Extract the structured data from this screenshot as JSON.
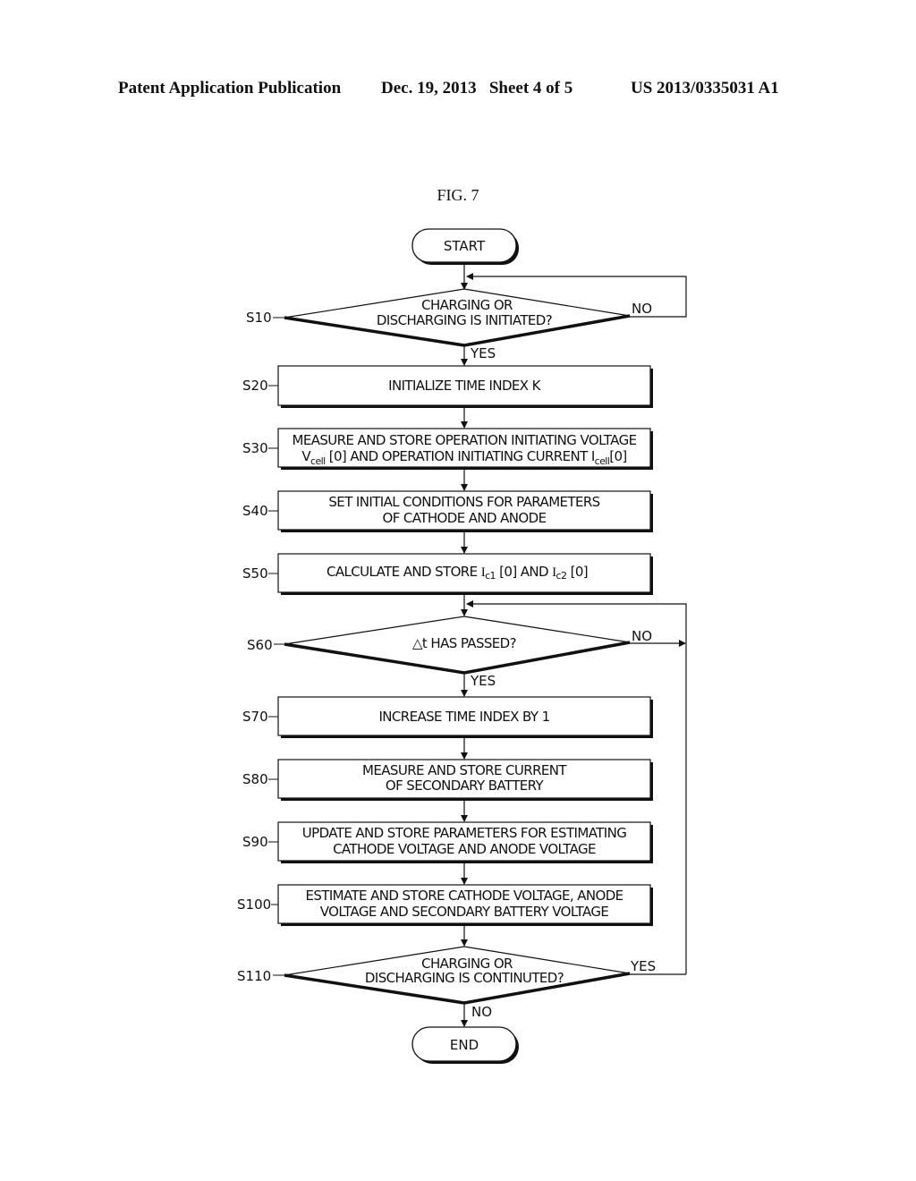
{
  "header": {
    "publication": "Patent Application Publication",
    "date_sheet": "Dec. 19, 2013   Sheet 4 of 5",
    "number": "US 2013/0335031 A1"
  },
  "figure": {
    "title": "FIG. 7"
  },
  "flowchart": {
    "start": "START",
    "end": "END",
    "steps": [
      {
        "id": "S10",
        "type": "decision",
        "lines": [
          "CHARGING OR",
          "DISCHARGING IS INITIATED?"
        ],
        "yes": "YES",
        "no": "NO"
      },
      {
        "id": "S20",
        "type": "process",
        "lines": [
          "INITIALIZE TIME INDEX K"
        ]
      },
      {
        "id": "S30",
        "type": "process",
        "lines": [
          "MEASURE AND STORE OPERATION INITIATING VOLTAGE",
          "V_cell [0] AND OPERATION INITIATING CURRENT I_cell[0]"
        ]
      },
      {
        "id": "S40",
        "type": "process",
        "lines": [
          "SET INITIAL CONDITIONS FOR PARAMETERS",
          "OF CATHODE AND ANODE"
        ]
      },
      {
        "id": "S50",
        "type": "process",
        "lines": [
          "CALCULATE AND STORE I_c1 [0] AND I_c2 [0]"
        ]
      },
      {
        "id": "S60",
        "type": "decision",
        "lines": [
          "△t HAS PASSED?"
        ],
        "yes": "YES",
        "no": "NO"
      },
      {
        "id": "S70",
        "type": "process",
        "lines": [
          "INCREASE TIME INDEX BY 1"
        ]
      },
      {
        "id": "S80",
        "type": "process",
        "lines": [
          "MEASURE AND STORE CURRENT",
          "OF SECONDARY BATTERY"
        ]
      },
      {
        "id": "S90",
        "type": "process",
        "lines": [
          "UPDATE AND STORE PARAMETERS FOR ESTIMATING",
          "CATHODE VOLTAGE AND ANODE VOLTAGE"
        ]
      },
      {
        "id": "S100",
        "type": "process",
        "lines": [
          "ESTIMATE AND STORE CATHODE VOLTAGE, ANODE",
          "VOLTAGE AND SECONDARY BATTERY VOLTAGE"
        ]
      },
      {
        "id": "S110",
        "type": "decision",
        "lines": [
          "CHARGING OR",
          "DISCHARGING IS CONTINUTED?"
        ],
        "yes": "YES",
        "no": "NO"
      }
    ],
    "s30_parts": {
      "line1": "MEASURE AND STORE OPERATION INITIATING VOLTAGE",
      "v": "V",
      "v_sub": "cell",
      "mid": " [0] AND OPERATION INITIATING CURRENT ",
      "i": "I",
      "i_sub": "cell",
      "tail": "[0]"
    },
    "s50_parts": {
      "pre": "CALCULATE AND STORE ",
      "i1": "I",
      "i1_sub": "c1",
      "mid": " [0] AND ",
      "i2": "I",
      "i2_sub": "c2",
      "tail": " [0]"
    }
  }
}
